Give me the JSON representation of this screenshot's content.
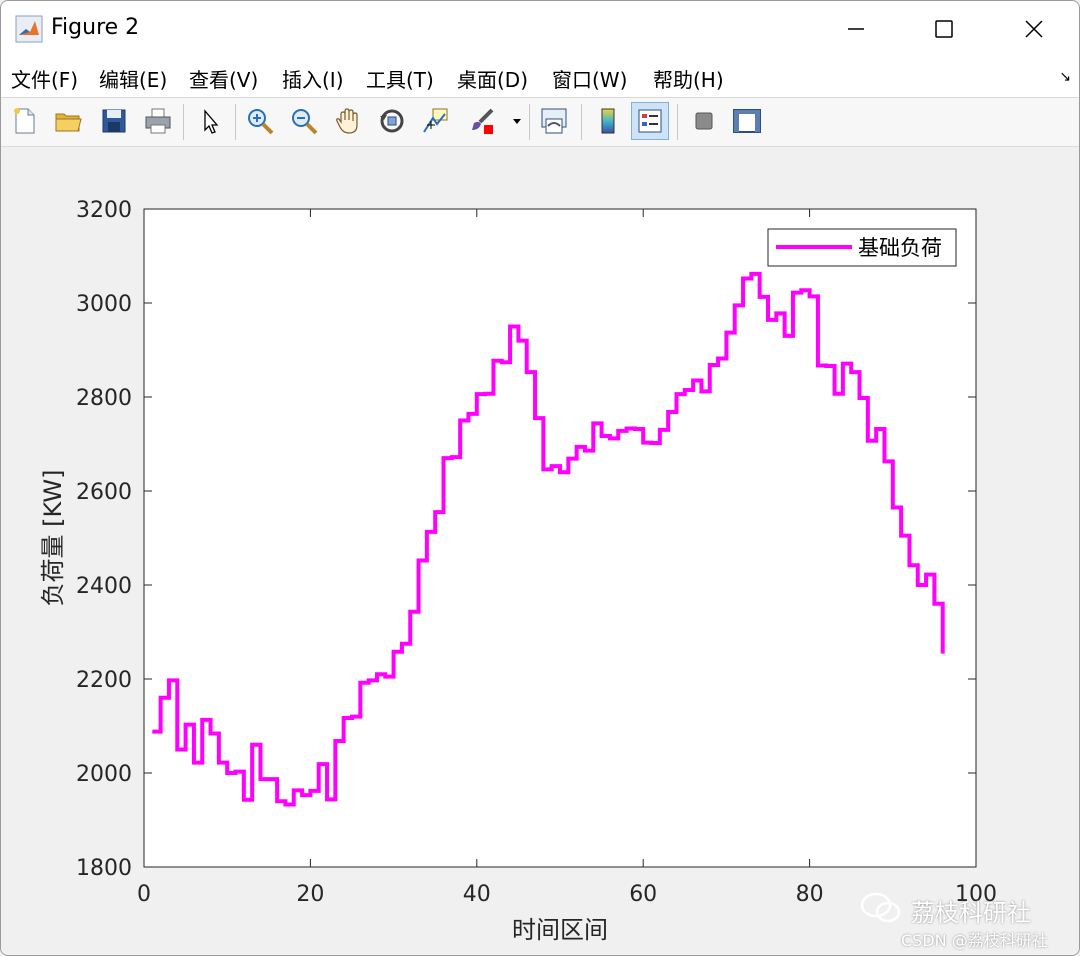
{
  "window": {
    "title": "Figure 2"
  },
  "menubar": {
    "items": [
      {
        "label": "文件(F)"
      },
      {
        "label": "编辑(E)"
      },
      {
        "label": "查看(V)"
      },
      {
        "label": "插入(I)"
      },
      {
        "label": "工具(T)"
      },
      {
        "label": "桌面(D)"
      },
      {
        "label": "窗口(W)"
      },
      {
        "label": "帮助(H)"
      }
    ]
  },
  "toolbar": {
    "icons": [
      "new-file-icon",
      "open-folder-icon",
      "save-icon",
      "print-icon",
      "select-arrow-icon",
      "zoom-in-icon",
      "zoom-out-icon",
      "pan-hand-icon",
      "rotate-3d-icon",
      "data-cursor-icon",
      "brush-icon",
      "brush-dropdown-icon",
      "link-plot-icon",
      "colorbar-icon",
      "legend-icon",
      "hide-plot-tools-icon",
      "show-plot-tools-icon"
    ]
  },
  "chart_data": {
    "type": "line",
    "style": "stairs",
    "xlabel": "时间区间",
    "ylabel": "负荷量 [KW]",
    "xlim": [
      0,
      100
    ],
    "ylim": [
      1800,
      3200
    ],
    "xticks": [
      "0",
      "20",
      "40",
      "60",
      "80",
      "100"
    ],
    "yticks": [
      "1800",
      "2000",
      "2200",
      "2400",
      "2600",
      "2800",
      "3000",
      "3200"
    ],
    "legend_position": "top-right",
    "grid": false,
    "series": [
      {
        "name": "基础负荷",
        "color": "#ff00ff",
        "x": [
          1,
          2,
          3,
          4,
          5,
          6,
          7,
          8,
          9,
          10,
          11,
          12,
          13,
          14,
          15,
          16,
          17,
          18,
          19,
          20,
          21,
          22,
          23,
          24,
          25,
          26,
          27,
          28,
          29,
          30,
          31,
          32,
          33,
          34,
          35,
          36,
          37,
          38,
          39,
          40,
          41,
          42,
          43,
          44,
          45,
          46,
          47,
          48,
          49,
          50,
          51,
          52,
          53,
          54,
          55,
          56,
          57,
          58,
          59,
          60,
          61,
          62,
          63,
          64,
          65,
          66,
          67,
          68,
          69,
          70,
          71,
          72,
          73,
          74,
          75,
          76,
          77,
          78,
          79,
          80,
          81,
          82,
          83,
          84,
          85,
          86,
          87,
          88,
          89,
          90,
          91,
          92,
          93,
          94,
          95,
          96
        ],
        "y": [
          2088,
          2160,
          2197,
          2050,
          2103,
          2022,
          2113,
          2084,
          2022,
          2000,
          2003,
          1943,
          2060,
          1987,
          1987,
          1940,
          1933,
          1963,
          1953,
          1962,
          2019,
          1944,
          2068,
          2117,
          2120,
          2192,
          2197,
          2210,
          2205,
          2258,
          2275,
          2343,
          2452,
          2513,
          2555,
          2670,
          2672,
          2750,
          2764,
          2806,
          2807,
          2877,
          2874,
          2950,
          2920,
          2853,
          2755,
          2646,
          2653,
          2640,
          2669,
          2694,
          2686,
          2744,
          2717,
          2712,
          2728,
          2733,
          2732,
          2703,
          2702,
          2730,
          2768,
          2806,
          2815,
          2835,
          2812,
          2868,
          2882,
          2937,
          2995,
          3052,
          3062,
          3013,
          2964,
          2978,
          2930,
          3022,
          3027,
          3014,
          2867,
          2866,
          2807,
          2871,
          2853,
          2798,
          2707,
          2732,
          2663,
          2565,
          2505,
          2442,
          2400,
          2422,
          2360,
          2254
        ]
      }
    ]
  },
  "watermark": {
    "main": "荔枝科研社",
    "sub": "CSDN @荔枝科研社"
  }
}
